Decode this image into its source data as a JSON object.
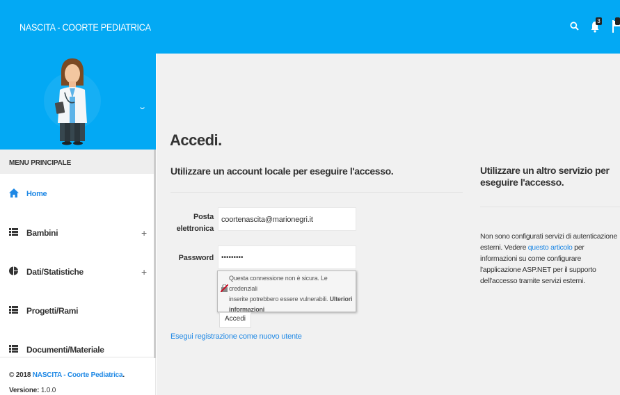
{
  "app": {
    "title": "NASCITA - COORTE PEDIATRICA",
    "accent_color": "#03a9f4",
    "notifications_count": "3"
  },
  "header_icons": [
    "search-icon",
    "bell-icon",
    "flag-icon"
  ],
  "sidebar": {
    "menu_header": "MENU PRINCIPALE",
    "items": [
      {
        "label": "Home",
        "icon": "home-icon",
        "expandable": false
      },
      {
        "label": "Bambini",
        "icon": "list-icon",
        "expandable": true
      },
      {
        "label": "Dati/Statistiche",
        "icon": "pie-chart-icon",
        "expandable": true
      },
      {
        "label": "Progetti/Rami",
        "icon": "list-icon",
        "expandable": false
      },
      {
        "label": "Documenti/Materiale",
        "icon": "list-icon",
        "expandable": false
      }
    ],
    "plus": "+",
    "footer": {
      "copyright_prefix": "© 2018 ",
      "copyright_link": "NASCITA - Coorte Pediatrica",
      "copyright_suffix": ".",
      "version_label": "Versione:",
      "version_value": " 1.0.0"
    }
  },
  "login": {
    "title": "Accedi.",
    "local_heading": "Utilizzare un account locale per eseguire l'accesso.",
    "email_label_line1": "Posta",
    "email_label_line2": "elettronica",
    "email_value": "coortenascita@marionegri.it",
    "password_label": "Password",
    "password_value": "•••••••••",
    "tooltip_line1": "Questa connessione non è sicura. Le credenziali",
    "tooltip_line2": "inserite potrebbero essere vulnerabili.",
    "tooltip_more_1": "Ulteriori",
    "tooltip_more_2": "informazioni",
    "submit_label": "Accedi",
    "register_link": "Esegui registrazione come nuovo utente"
  },
  "external": {
    "heading": "Utilizzare un altro servizio per eseguire l'accesso.",
    "text_before": "Non sono configurati servizi di autenticazione esterni. Vedere ",
    "link_text": "questo articolo",
    "text_after": " per informazioni su come configurare l'applicazione ASP.NET per il supporto dell'accesso tramite servizi esterni."
  }
}
